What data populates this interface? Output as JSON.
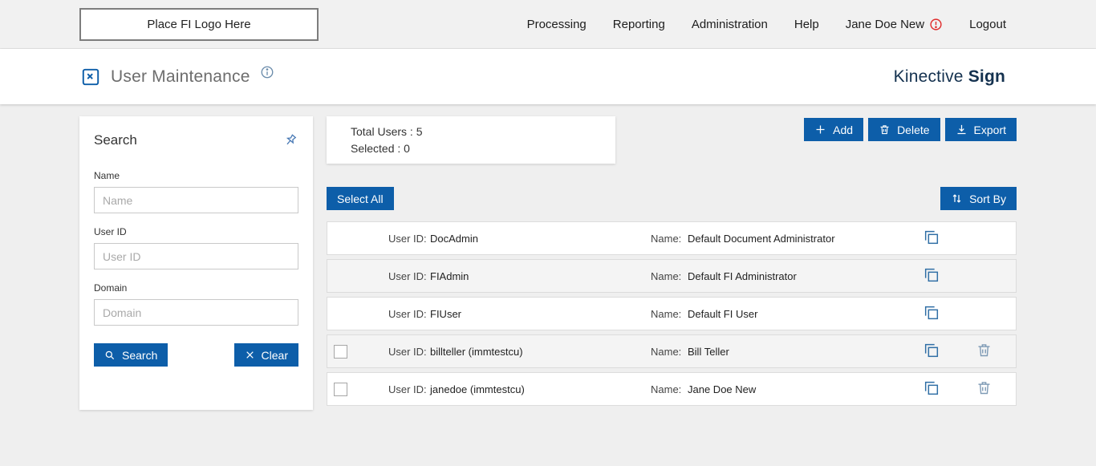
{
  "header": {
    "logo_placeholder": "Place FI Logo Here",
    "nav": [
      {
        "label": "Processing"
      },
      {
        "label": "Reporting"
      },
      {
        "label": "Administration"
      },
      {
        "label": "Help"
      },
      {
        "label": "Jane Doe New"
      },
      {
        "label": "Logout"
      }
    ]
  },
  "subheader": {
    "page_title": "User Maintenance",
    "brand_regular": "Kinective",
    "brand_bold": "Sign"
  },
  "search_panel": {
    "title": "Search",
    "fields": [
      {
        "label": "Name",
        "placeholder": "Name",
        "value": ""
      },
      {
        "label": "User ID",
        "placeholder": "User ID",
        "value": ""
      },
      {
        "label": "Domain",
        "placeholder": "Domain",
        "value": ""
      }
    ],
    "search_button": "Search",
    "clear_button": "Clear"
  },
  "summary": {
    "total_users": "Total Users : 5",
    "selected": "Selected : 0"
  },
  "toolbar": {
    "add": "Add",
    "delete": "Delete",
    "export": "Export",
    "select_all": "Select All",
    "sort_by": "Sort By"
  },
  "user_list": {
    "user_id_label": "User ID:",
    "name_label": "Name:",
    "rows": [
      {
        "user_id": "DocAdmin",
        "name": "Default Document Administrator"
      },
      {
        "user_id": "FIAdmin",
        "name": "Default FI Administrator"
      },
      {
        "user_id": "FIUser",
        "name": "Default FI User"
      },
      {
        "user_id": "billteller (immtestcu)",
        "name": "Bill Teller"
      },
      {
        "user_id": "janedoe (immtestcu)",
        "name": "Jane Doe New"
      }
    ]
  },
  "colors": {
    "accent_blue": "#0d5ea9",
    "brand_navy": "#14314f",
    "alert_red": "#e02b2b"
  }
}
